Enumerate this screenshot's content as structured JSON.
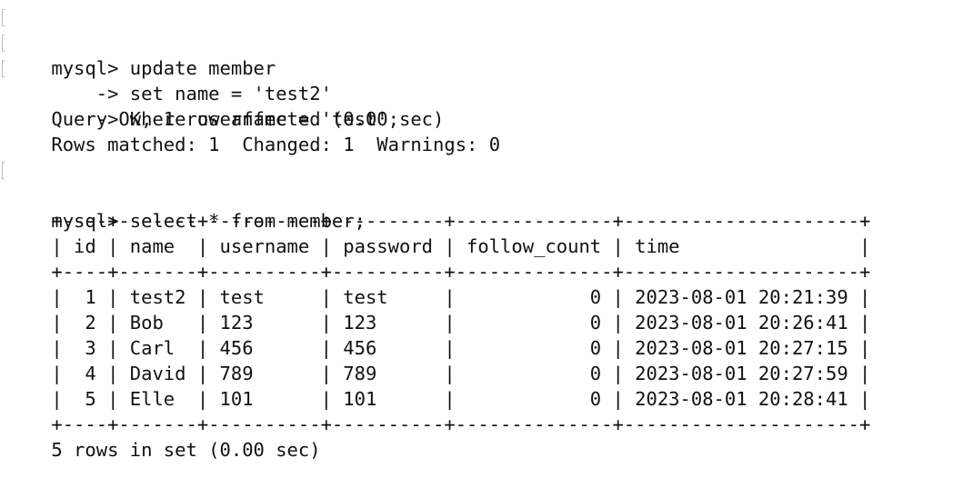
{
  "terminal": {
    "update_prompt": "mysql> update member",
    "update_line2": "    -> set name = 'test2'",
    "update_line3": "    -> where username = 'test';",
    "update_result1": "Query OK, 1 row affected (0.00 sec)",
    "update_result2": "Rows matched: 1  Changed: 1  Warnings: 0",
    "select_prompt": "mysql> select * from member;",
    "table_border": "+----+-------+----------+----------+--------------+---------------------+",
    "table_header": "| id | name  | username | password | follow_count | time                |",
    "rows": [
      "|  1 | test2 | test     | test     |            0 | 2023-08-01 20:21:39 |",
      "|  2 | Bob   | 123      | 123      |            0 | 2023-08-01 20:26:41 |",
      "|  3 | Carl  | 456      | 456      |            0 | 2023-08-01 20:27:15 |",
      "|  4 | David | 789      | 789      |            0 | 2023-08-01 20:27:59 |",
      "|  5 | Elle  | 101      | 101      |            0 | 2023-08-01 20:28:41 |"
    ],
    "footer": "5 rows in set (0.00 sec)"
  }
}
